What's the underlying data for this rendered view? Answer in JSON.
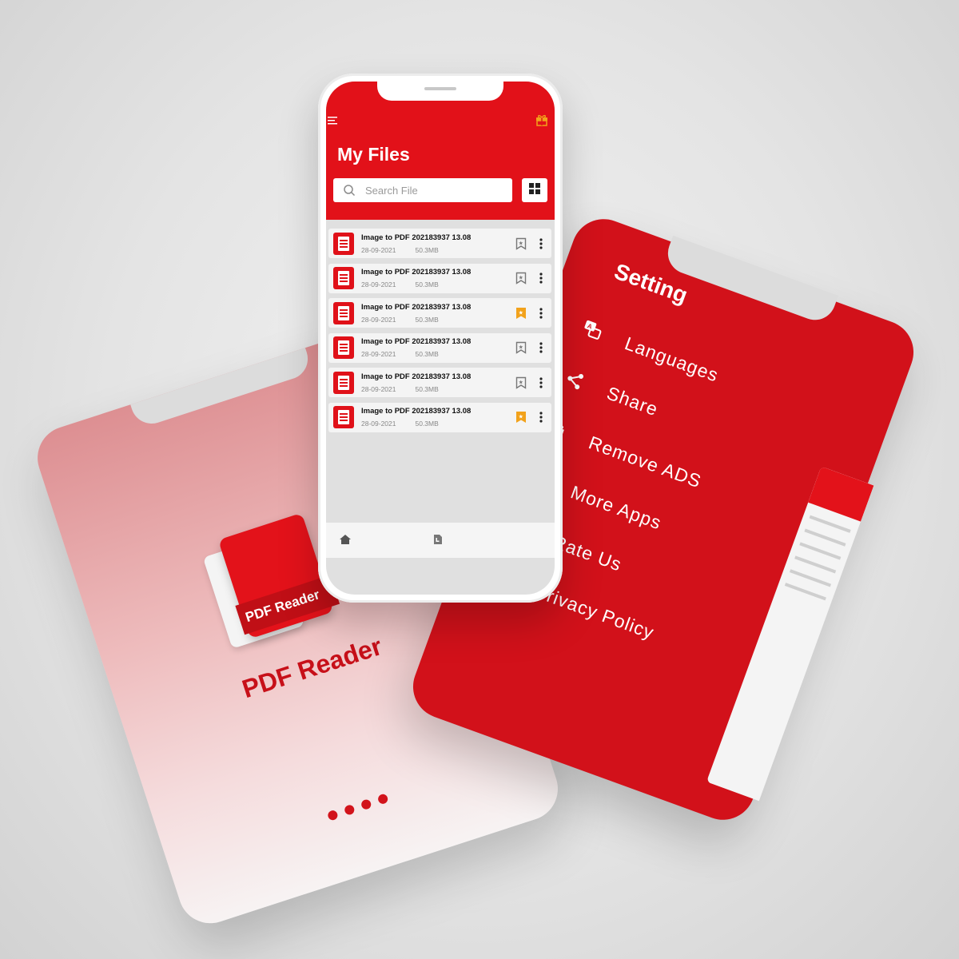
{
  "splash": {
    "logo_label": "PDF Reader",
    "app_name": "PDF Reader",
    "page_dots": 4,
    "accent_color": "#d2131b"
  },
  "files": {
    "title": "My Files",
    "menu_icon": "hamburger-menu-icon",
    "gift_icon": "gift-icon",
    "search": {
      "placeholder": "Search File",
      "icon": "search-icon"
    },
    "view_toggle_icon": "grid-view-icon",
    "items": [
      {
        "name": "Image to PDF 202183937 13.08",
        "date": "28-09-2021",
        "size": "50.3MB",
        "bookmarked": false
      },
      {
        "name": "Image to PDF 202183937 13.08",
        "date": "28-09-2021",
        "size": "50.3MB",
        "bookmarked": false
      },
      {
        "name": "Image to PDF 202183937 13.08",
        "date": "28-09-2021",
        "size": "50.3MB",
        "bookmarked": true
      },
      {
        "name": "Image to PDF 202183937 13.08",
        "date": "28-09-2021",
        "size": "50.3MB",
        "bookmarked": false
      },
      {
        "name": "Image to PDF 202183937 13.08",
        "date": "28-09-2021",
        "size": "50.3MB",
        "bookmarked": false
      },
      {
        "name": "Image to PDF 202183937 13.08",
        "date": "28-09-2021",
        "size": "50.3MB",
        "bookmarked": true
      }
    ],
    "bottom_nav": [
      "home-icon",
      "file-icon"
    ],
    "colors": {
      "header": "#e21119",
      "bookmark_active": "#f2a21b",
      "bookmark_inactive": "#777777"
    }
  },
  "settings": {
    "title": "Setting",
    "items": [
      {
        "label": "Languages",
        "icon": "translate-icon"
      },
      {
        "label": "Share",
        "icon": "share-icon"
      },
      {
        "label": "Remove ADS",
        "icon": "gift-icon"
      },
      {
        "label": "More Apps",
        "icon": "apps-icon"
      },
      {
        "label": "Rate Us",
        "icon": "stars-icon"
      },
      {
        "label": "Privacy Policy",
        "icon": "lock-icon"
      }
    ],
    "background": "#d2111a"
  }
}
